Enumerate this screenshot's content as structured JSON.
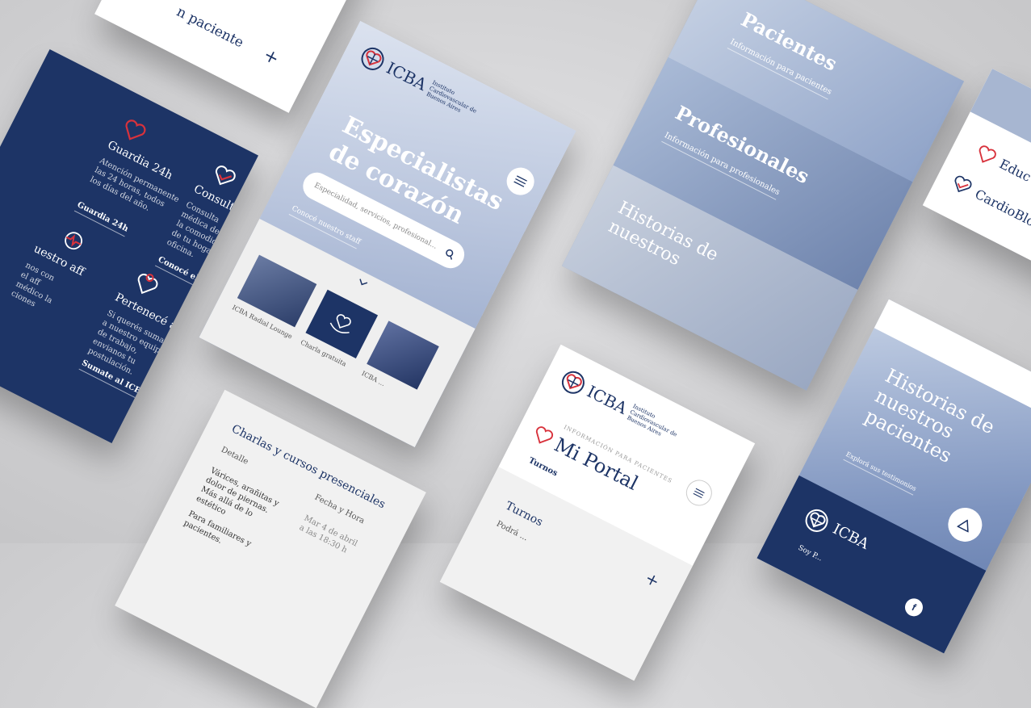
{
  "brand": {
    "name": "ICBA",
    "subtitle": "Instituto Cardiovascular de Buenos Aires",
    "navy": "#1d3466",
    "red": "#d8323c"
  },
  "card_top_left": {
    "text": "n paciente",
    "plus": "+"
  },
  "services": {
    "items": [
      {
        "title": "Guardia 24h",
        "desc": "Atención permanente las 24 horas, todos los días del año.",
        "link": "Guardia 24h",
        "icon": "heart-pulse-icon"
      },
      {
        "title": "Consultorio Virtual",
        "desc": "Consulta médica desde la comodidad de tu hogar u oficina.",
        "link": "Conocé el servicio",
        "icon": "heart-check-icon"
      },
      {
        "title": "uestro aff",
        "desc": "nos con el aff médico la ciones",
        "link": "",
        "icon": "heart-ecg-icon"
      },
      {
        "title": "Pertenecé al ICBA",
        "desc": "Si querés sumarte a nuestro equipo de trabajo, envianos tu postulación.",
        "link": "Sumate al ICBA",
        "icon": "heart-pin-icon"
      }
    ]
  },
  "home": {
    "hero_title_1": "Especialistas",
    "hero_title_2": "de corazón",
    "search_placeholder": "Especialidad, servicios, profesional...",
    "staff_link": "Conocé nuestro staff",
    "carousel": [
      {
        "label": "ICBA Radial Lounge"
      },
      {
        "label": "Charla gratuita"
      },
      {
        "label": "ICBA ..."
      }
    ]
  },
  "sections": {
    "pacientes": {
      "title": "Pacientes",
      "sub": "Información para pacientes"
    },
    "profesionales": {
      "title": "Profesionales",
      "sub": "Información para profesionales"
    },
    "historias": {
      "title": "Historias de nuestros",
      "sub": ""
    }
  },
  "right_card": {
    "items": [
      "Educ",
      "CardioBlog"
    ]
  },
  "charlas": {
    "title": "Charlas y cursos presenciales",
    "col_detail": "Detalle",
    "col_date": "Fecha y Hora",
    "rows": [
      {
        "detail": "Várices, arañitas y dolor de piernas. Más allá de lo estético",
        "date": "Mar 4 de abril a las 18:30 h"
      },
      {
        "detail": "Para familiares y pacientes.",
        "date": ""
      }
    ]
  },
  "portal": {
    "eyebrow": "INFORMACIÓN PARA PACIENTES",
    "title": "Mi Portal",
    "tab": "Turnos",
    "section": "Turnos",
    "body": "Podrá ...",
    "plus": "+"
  },
  "historias_card": {
    "title": "Historias de nuestros pacientes",
    "link": "Explorá sus testimonios",
    "footer_brand": "ICBA",
    "footer_text": "Soy P..."
  }
}
